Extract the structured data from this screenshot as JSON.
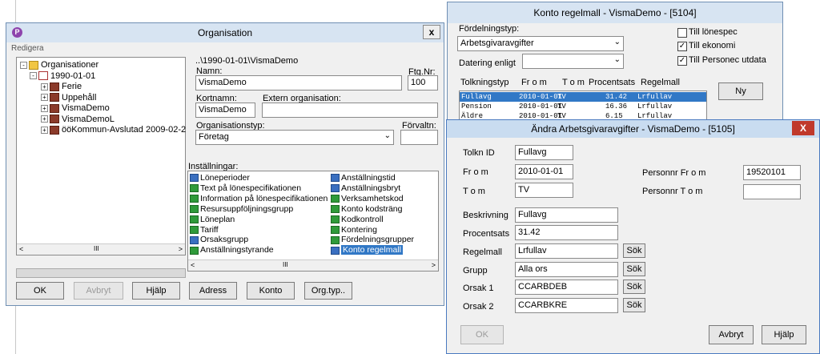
{
  "org_window": {
    "title": "Organisation",
    "close": "x",
    "menu_redigera": "Redigera",
    "tree": [
      {
        "label": "Organisationer",
        "pm": "-"
      },
      {
        "label": "1990-01-01",
        "pm": "-"
      },
      {
        "label": "Ferie",
        "pm": "+"
      },
      {
        "label": "Uppehåll",
        "pm": "+"
      },
      {
        "label": "VismaDemo",
        "pm": "+"
      },
      {
        "label": "VismaDemoL",
        "pm": "+"
      },
      {
        "label": "ööKommun-Avslutad 2009-02-2",
        "pm": "+"
      }
    ],
    "scroll_mark": "III",
    "path": "..\\1990-01-01\\VismaDemo",
    "namn_label": "Namn:",
    "namn_value": "VismaDemo",
    "ftgnr_label": "Ftg.Nr:",
    "ftgnr_value": "100",
    "kortnamn_label": "Kortnamn:",
    "kortnamn_value": "VismaDemo",
    "extern_label": "Extern organisation:",
    "extern_value": "",
    "orgtyp_label": "Organisationstyp:",
    "orgtyp_value": "Företag",
    "forvaltn_label": "Förvaltn:",
    "forvaltn_value": "",
    "installningar_label": "Inställningar:",
    "installningar_col1": [
      "Löneperioder",
      "Text på lönespecifikationen",
      "Information på lönespecifikationen",
      "Resursuppföljningsgrupp",
      "Löneplan",
      "Tariff",
      "Orsaksgrupp",
      "Anställningstyrande"
    ],
    "installningar_col2": [
      "Anställningstid",
      "Anställningsbryt",
      "Verksamhetskod",
      "Konto kodsträng",
      "Kodkontroll",
      "Kontering",
      "Fördelningsgrupper",
      "Konto regelmall"
    ],
    "buttons": {
      "ok": "OK",
      "avbryt": "Avbryt",
      "hjalp": "Hjälp",
      "adress": "Adress",
      "konto": "Konto",
      "orgtyp": "Org.typ.."
    }
  },
  "konto_window": {
    "title": "Konto regelmall - VismaDemo - [5104]",
    "fordelningstyp_label": "Fördelningstyp:",
    "fordelningstyp_value": "Arbetsgivaravgifter",
    "datering_label": "Datering enligt",
    "datering_value": "",
    "checks": [
      {
        "label": "Till lönespec",
        "checked": false
      },
      {
        "label": "Till ekonomi",
        "checked": true
      },
      {
        "label": "Till Personec utdata",
        "checked": true
      }
    ],
    "columns": [
      "Tolkningstyp",
      "Fr o m",
      "T o m",
      "Procentsats",
      "Regelmall"
    ],
    "rows": [
      {
        "typ": "Fullavg",
        "from": "2010-01-01",
        "tom": "TV",
        "pct": "31.42",
        "regel": "Lrfullav"
      },
      {
        "typ": "Pension",
        "from": "2010-01-01",
        "tom": "TV",
        "pct": "16.36",
        "regel": "Lrfullav"
      },
      {
        "typ": "Äldre",
        "from": "2010-01-01",
        "tom": "TV",
        "pct": "6.15",
        "regel": "Lrfullav"
      }
    ],
    "ny_button": "Ny"
  },
  "andra_window": {
    "title": "Ändra Arbetsgivaravgifter - VismaDemo - [5105]",
    "close": "X",
    "tolkn_label": "Tolkn ID",
    "tolkn_value": "Fullavg",
    "from_label": "Fr o m",
    "from_value": "2010-01-01",
    "tom_label": "T o m",
    "tom_value": "TV",
    "pnr_from_label": "Personnr Fr o m",
    "pnr_from_value": "19520101",
    "pnr_tom_label": "Personnr T o m",
    "pnr_tom_value": "",
    "beskrivning_label": "Beskrivning",
    "beskrivning_value": "Fullavg",
    "procentsats_label": "Procentsats",
    "procentsats_value": "31.42",
    "regelmall_label": "Regelmall",
    "regelmall_value": "Lrfullav",
    "grupp_label": "Grupp",
    "grupp_value": "Alla ors",
    "orsak1_label": "Orsak 1",
    "orsak1_value": "CCARBDEB",
    "orsak2_label": "Orsak 2",
    "orsak2_value": "CCARBKRE",
    "sok": "Sök",
    "ok": "OK",
    "avbryt": "Avbryt",
    "hjalp": "Hjälp"
  }
}
